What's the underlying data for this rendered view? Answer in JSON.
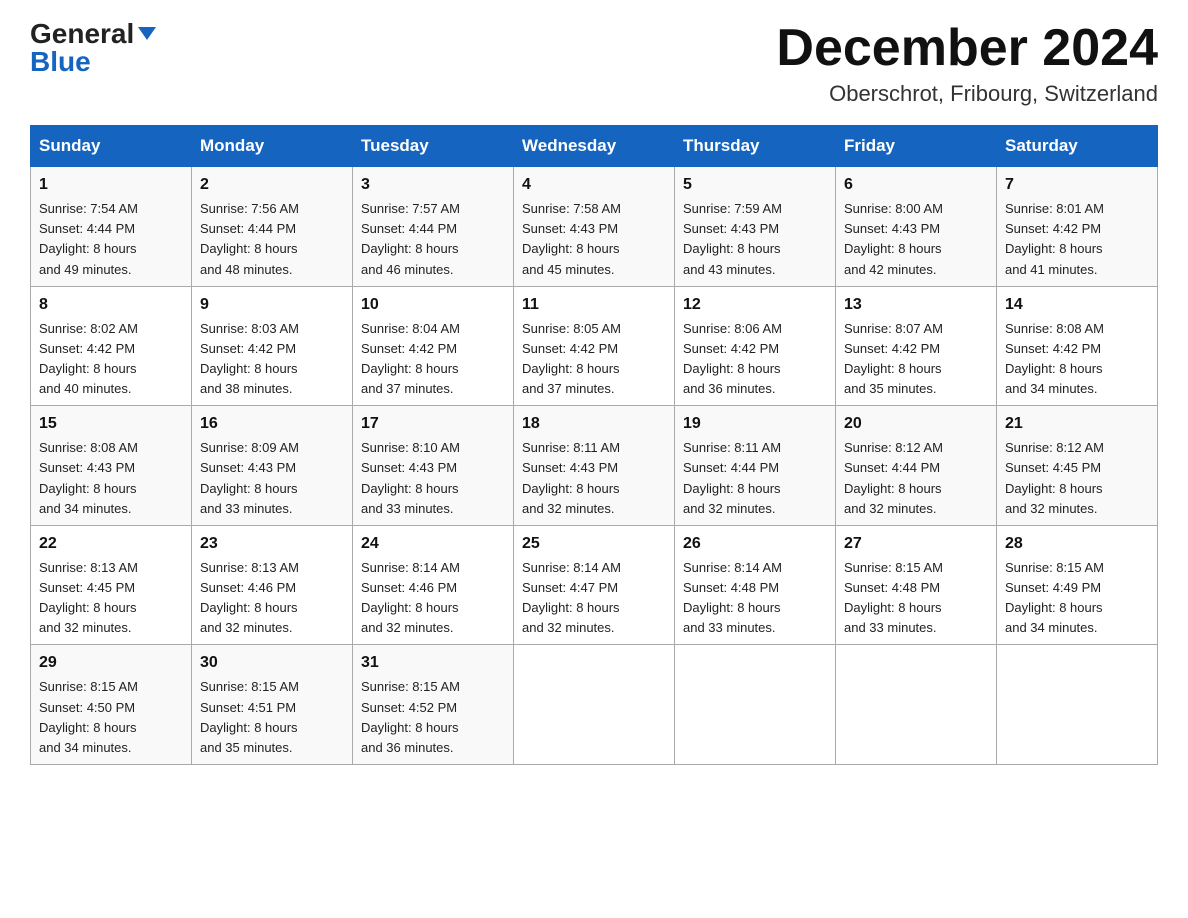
{
  "header": {
    "logo_line1": "General",
    "logo_line2": "Blue",
    "month_title": "December 2024",
    "location": "Oberschrot, Fribourg, Switzerland"
  },
  "days_of_week": [
    "Sunday",
    "Monday",
    "Tuesday",
    "Wednesday",
    "Thursday",
    "Friday",
    "Saturday"
  ],
  "weeks": [
    [
      {
        "day": "1",
        "sunrise": "7:54 AM",
        "sunset": "4:44 PM",
        "daylight": "8 hours and 49 minutes."
      },
      {
        "day": "2",
        "sunrise": "7:56 AM",
        "sunset": "4:44 PM",
        "daylight": "8 hours and 48 minutes."
      },
      {
        "day": "3",
        "sunrise": "7:57 AM",
        "sunset": "4:44 PM",
        "daylight": "8 hours and 46 minutes."
      },
      {
        "day": "4",
        "sunrise": "7:58 AM",
        "sunset": "4:43 PM",
        "daylight": "8 hours and 45 minutes."
      },
      {
        "day": "5",
        "sunrise": "7:59 AM",
        "sunset": "4:43 PM",
        "daylight": "8 hours and 43 minutes."
      },
      {
        "day": "6",
        "sunrise": "8:00 AM",
        "sunset": "4:43 PM",
        "daylight": "8 hours and 42 minutes."
      },
      {
        "day": "7",
        "sunrise": "8:01 AM",
        "sunset": "4:42 PM",
        "daylight": "8 hours and 41 minutes."
      }
    ],
    [
      {
        "day": "8",
        "sunrise": "8:02 AM",
        "sunset": "4:42 PM",
        "daylight": "8 hours and 40 minutes."
      },
      {
        "day": "9",
        "sunrise": "8:03 AM",
        "sunset": "4:42 PM",
        "daylight": "8 hours and 38 minutes."
      },
      {
        "day": "10",
        "sunrise": "8:04 AM",
        "sunset": "4:42 PM",
        "daylight": "8 hours and 37 minutes."
      },
      {
        "day": "11",
        "sunrise": "8:05 AM",
        "sunset": "4:42 PM",
        "daylight": "8 hours and 37 minutes."
      },
      {
        "day": "12",
        "sunrise": "8:06 AM",
        "sunset": "4:42 PM",
        "daylight": "8 hours and 36 minutes."
      },
      {
        "day": "13",
        "sunrise": "8:07 AM",
        "sunset": "4:42 PM",
        "daylight": "8 hours and 35 minutes."
      },
      {
        "day": "14",
        "sunrise": "8:08 AM",
        "sunset": "4:42 PM",
        "daylight": "8 hours and 34 minutes."
      }
    ],
    [
      {
        "day": "15",
        "sunrise": "8:08 AM",
        "sunset": "4:43 PM",
        "daylight": "8 hours and 34 minutes."
      },
      {
        "day": "16",
        "sunrise": "8:09 AM",
        "sunset": "4:43 PM",
        "daylight": "8 hours and 33 minutes."
      },
      {
        "day": "17",
        "sunrise": "8:10 AM",
        "sunset": "4:43 PM",
        "daylight": "8 hours and 33 minutes."
      },
      {
        "day": "18",
        "sunrise": "8:11 AM",
        "sunset": "4:43 PM",
        "daylight": "8 hours and 32 minutes."
      },
      {
        "day": "19",
        "sunrise": "8:11 AM",
        "sunset": "4:44 PM",
        "daylight": "8 hours and 32 minutes."
      },
      {
        "day": "20",
        "sunrise": "8:12 AM",
        "sunset": "4:44 PM",
        "daylight": "8 hours and 32 minutes."
      },
      {
        "day": "21",
        "sunrise": "8:12 AM",
        "sunset": "4:45 PM",
        "daylight": "8 hours and 32 minutes."
      }
    ],
    [
      {
        "day": "22",
        "sunrise": "8:13 AM",
        "sunset": "4:45 PM",
        "daylight": "8 hours and 32 minutes."
      },
      {
        "day": "23",
        "sunrise": "8:13 AM",
        "sunset": "4:46 PM",
        "daylight": "8 hours and 32 minutes."
      },
      {
        "day": "24",
        "sunrise": "8:14 AM",
        "sunset": "4:46 PM",
        "daylight": "8 hours and 32 minutes."
      },
      {
        "day": "25",
        "sunrise": "8:14 AM",
        "sunset": "4:47 PM",
        "daylight": "8 hours and 32 minutes."
      },
      {
        "day": "26",
        "sunrise": "8:14 AM",
        "sunset": "4:48 PM",
        "daylight": "8 hours and 33 minutes."
      },
      {
        "day": "27",
        "sunrise": "8:15 AM",
        "sunset": "4:48 PM",
        "daylight": "8 hours and 33 minutes."
      },
      {
        "day": "28",
        "sunrise": "8:15 AM",
        "sunset": "4:49 PM",
        "daylight": "8 hours and 34 minutes."
      }
    ],
    [
      {
        "day": "29",
        "sunrise": "8:15 AM",
        "sunset": "4:50 PM",
        "daylight": "8 hours and 34 minutes."
      },
      {
        "day": "30",
        "sunrise": "8:15 AM",
        "sunset": "4:51 PM",
        "daylight": "8 hours and 35 minutes."
      },
      {
        "day": "31",
        "sunrise": "8:15 AM",
        "sunset": "4:52 PM",
        "daylight": "8 hours and 36 minutes."
      },
      null,
      null,
      null,
      null
    ]
  ],
  "labels": {
    "sunrise": "Sunrise:",
    "sunset": "Sunset:",
    "daylight": "Daylight:"
  }
}
